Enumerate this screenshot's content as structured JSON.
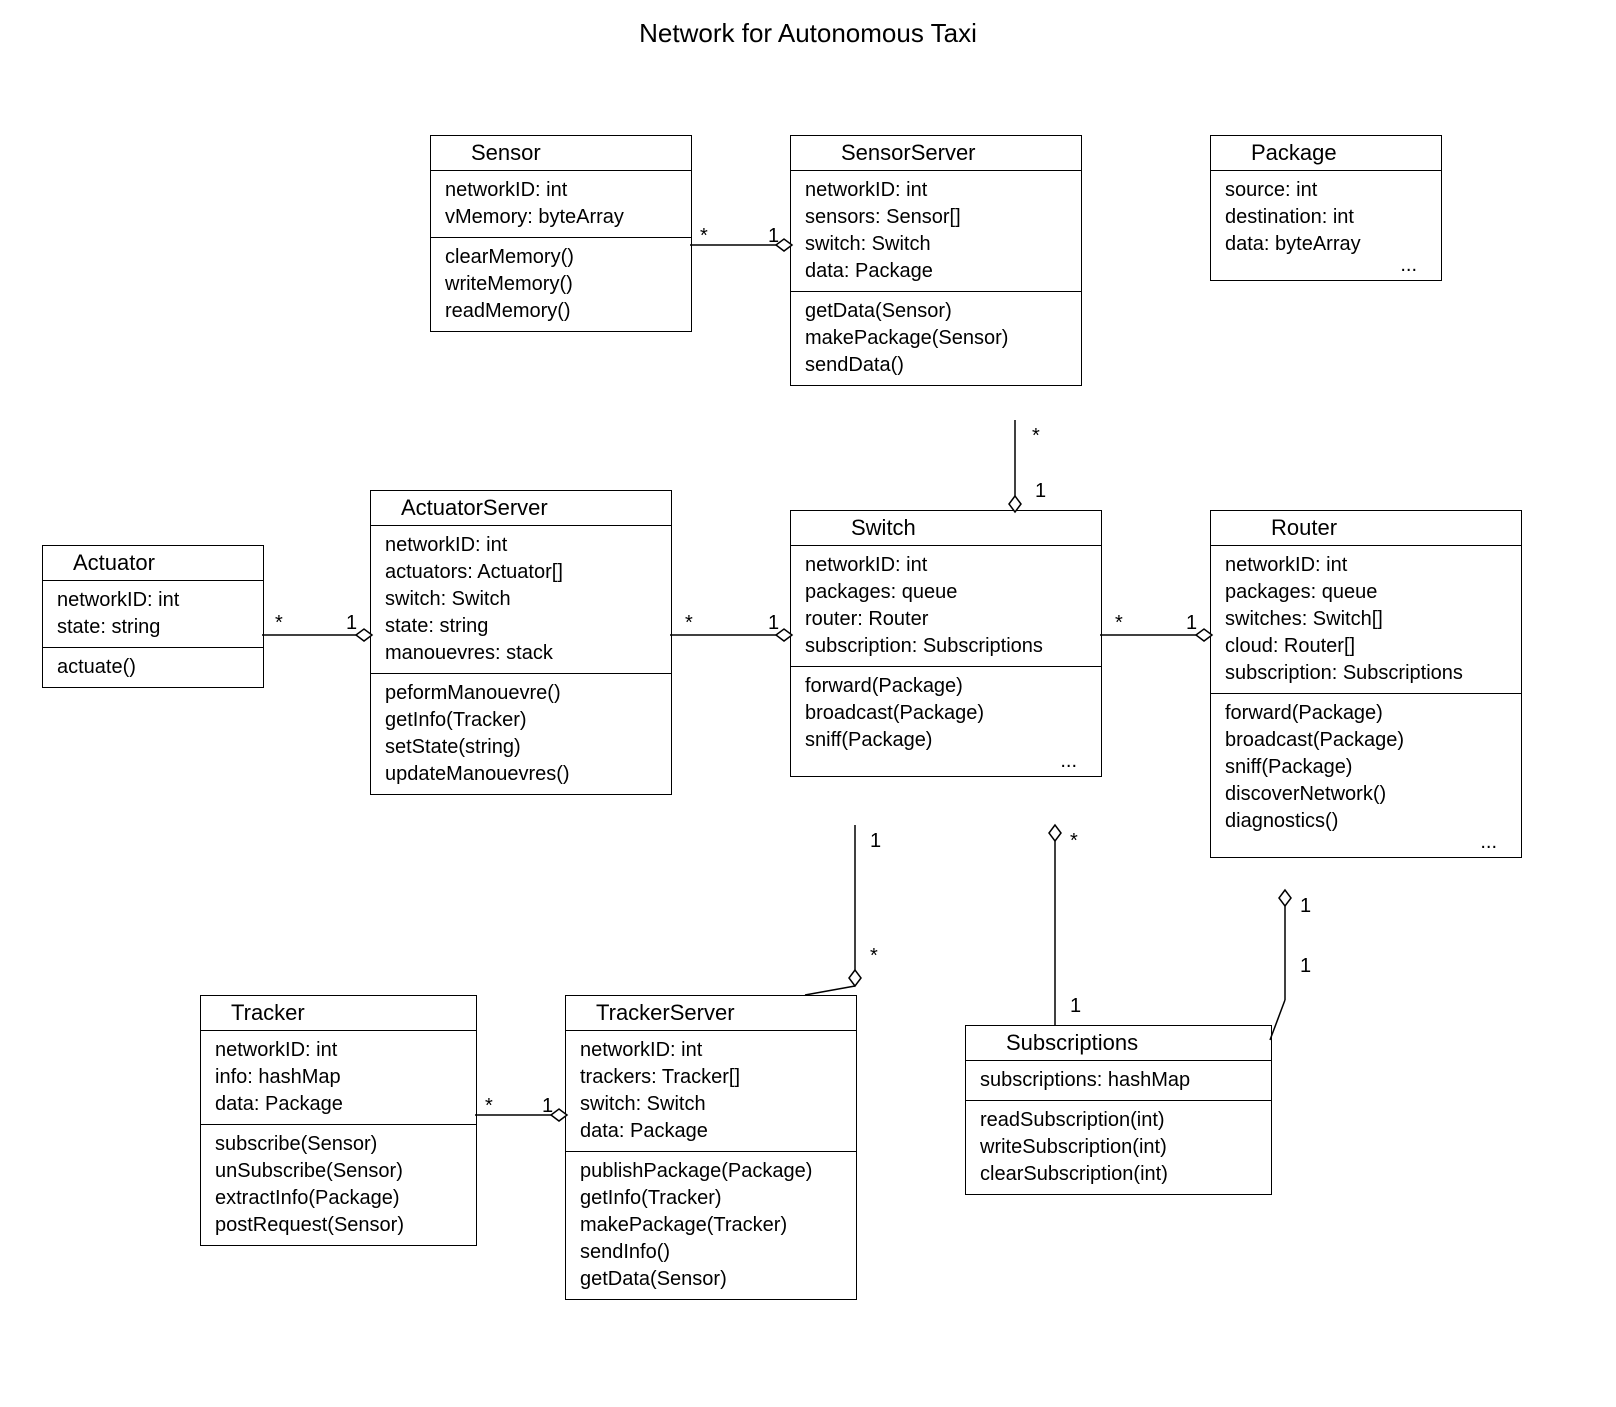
{
  "title": "Network for Autonomous Taxi",
  "classes": {
    "sensor": {
      "name": "Sensor",
      "attrs": [
        "networkID: int",
        "vMemory: byteArray"
      ],
      "methods": [
        "clearMemory()",
        "writeMemory()",
        "readMemory()"
      ]
    },
    "sensorserver": {
      "name": "SensorServer",
      "attrs": [
        "networkID: int",
        "sensors: Sensor[]",
        "switch: Switch",
        "data: Package"
      ],
      "methods": [
        "getData(Sensor)",
        "makePackage(Sensor)",
        "sendData()"
      ]
    },
    "package": {
      "name": "Package",
      "attrs": [
        "source: int",
        "destination: int",
        "data: byteArray"
      ],
      "more": "..."
    },
    "actuator": {
      "name": "Actuator",
      "attrs": [
        "networkID: int",
        "state: string"
      ],
      "methods": [
        "actuate()"
      ]
    },
    "actuatorserver": {
      "name": "ActuatorServer",
      "attrs": [
        "networkID: int",
        "actuators: Actuator[]",
        "switch: Switch",
        "state: string",
        "manouevres: stack"
      ],
      "methods": [
        "peformManouevre()",
        "getInfo(Tracker)",
        "setState(string)",
        "updateManouevres()"
      ]
    },
    "switch": {
      "name": "Switch",
      "attrs": [
        "networkID: int",
        "packages: queue",
        "router: Router",
        "subscription: Subscriptions"
      ],
      "methods": [
        "forward(Package)",
        "broadcast(Package)",
        "sniff(Package)"
      ],
      "more": "..."
    },
    "router": {
      "name": "Router",
      "attrs": [
        "networkID: int",
        "packages: queue",
        "switches: Switch[]",
        "cloud: Router[]",
        "subscription: Subscriptions"
      ],
      "methods": [
        "forward(Package)",
        "broadcast(Package)",
        "sniff(Package)",
        "discoverNetwork()",
        "diagnostics()"
      ],
      "more": "..."
    },
    "tracker": {
      "name": "Tracker",
      "attrs": [
        "networkID: int",
        "info: hashMap",
        "data: Package"
      ],
      "methods": [
        "subscribe(Sensor)",
        "unSubscribe(Sensor)",
        "extractInfo(Package)",
        "postRequest(Sensor)"
      ]
    },
    "trackerserver": {
      "name": "TrackerServer",
      "attrs": [
        "networkID: int",
        "trackers: Tracker[]",
        "switch: Switch",
        "data: Package"
      ],
      "methods": [
        "publishPackage(Package)",
        "getInfo(Tracker)",
        "makePackage(Tracker)",
        "sendInfo()",
        "getData(Sensor)"
      ]
    },
    "subscriptions": {
      "name": "Subscriptions",
      "attrs": [
        "subscriptions: hashMap"
      ],
      "methods": [
        "readSubscription(int)",
        "writeSubscription(int)",
        "clearSubscription(int)"
      ]
    }
  },
  "mult": {
    "sensor_sensorserver_l": "*",
    "sensor_sensorserver_r": "1",
    "sensorserver_switch_t": "*",
    "sensorserver_switch_b": "1",
    "actuator_actuatorserver_l": "*",
    "actuator_actuatorserver_r": "1",
    "actuatorserver_switch_l": "*",
    "actuatorserver_switch_r": "1",
    "switch_router_l": "*",
    "switch_router_r": "1",
    "switch_trackerserver_t": "1",
    "switch_trackerserver_b": "*",
    "switch_subscriptions_t": "*",
    "switch_subscriptions_b": "1",
    "router_subscriptions_t": "1",
    "router_subscriptions_b": "1",
    "tracker_trackerserver_l": "*",
    "tracker_trackerserver_r": "1"
  }
}
